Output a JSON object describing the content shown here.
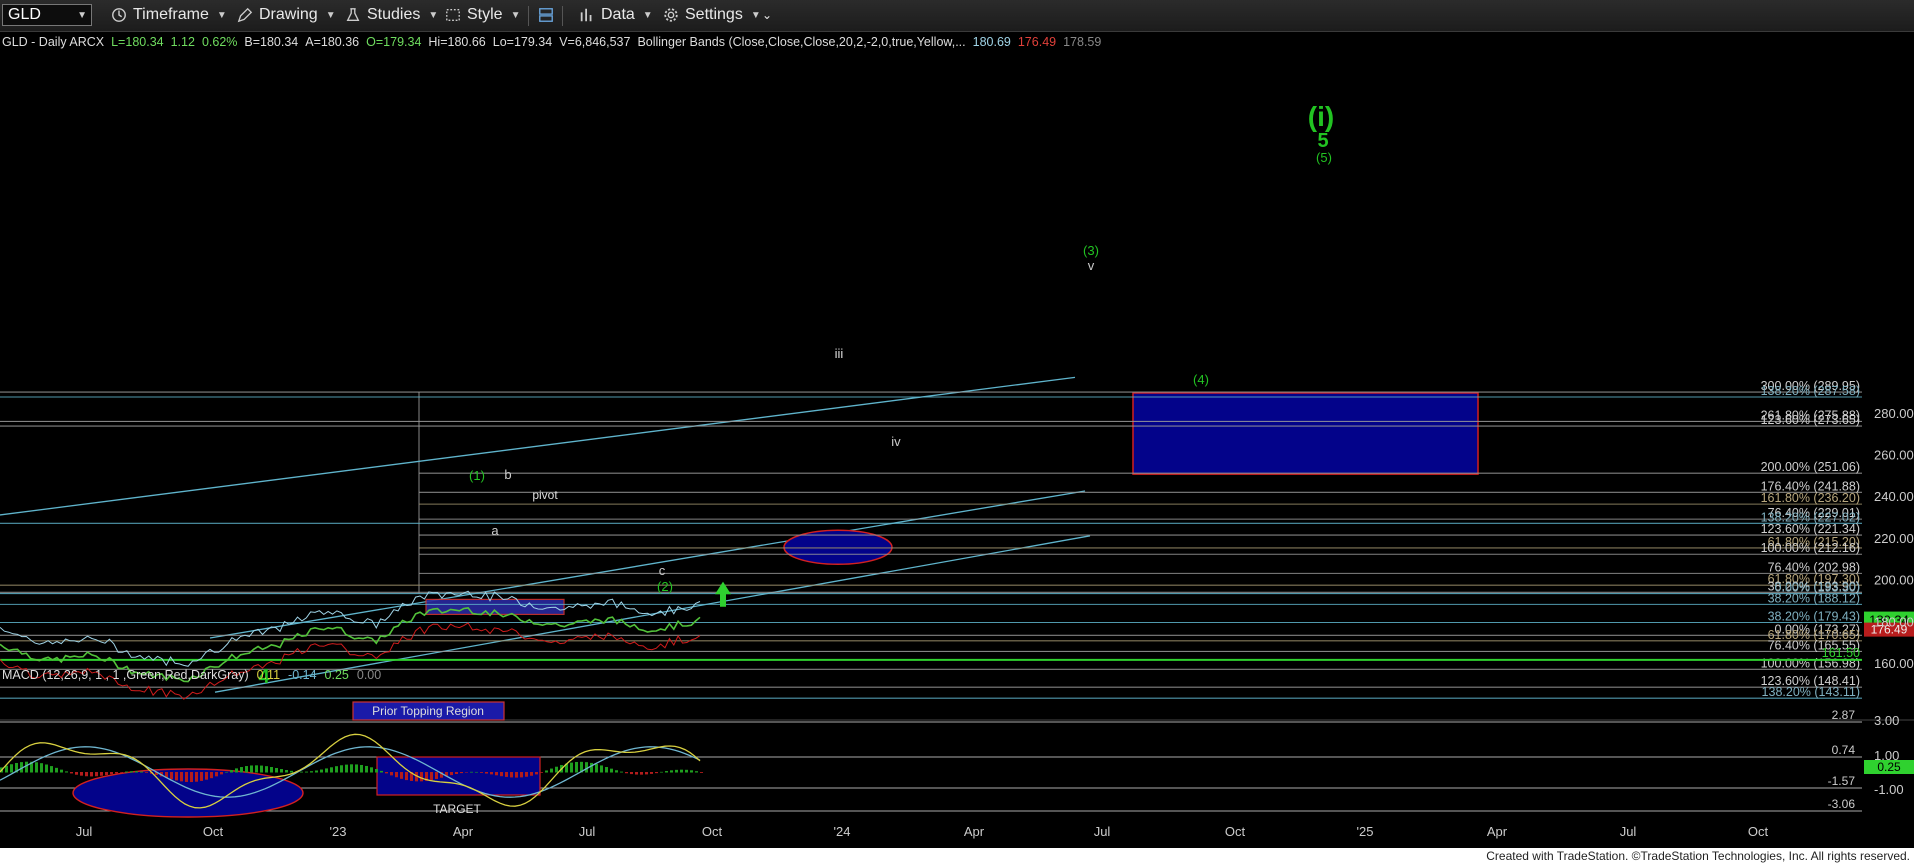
{
  "toolbar": {
    "symbol": "GLD",
    "timeframe_label": "Timeframe",
    "drawing_label": "Drawing",
    "studies_label": "Studies",
    "style_label": "Style",
    "data_label": "Data",
    "settings_label": "Settings"
  },
  "header": {
    "symbol_desc": "GLD - Daily  ARCX",
    "last": "L=180.34",
    "change": "1.12",
    "change_pct": "0.62%",
    "bid": "B=180.34",
    "ask": "A=180.36",
    "open": "O=179.34",
    "high": "Hi=180.66",
    "low": "Lo=179.34",
    "volume": "V=6,846,537",
    "study": "Bollinger Bands (Close,Close,Close,20,2,-2,0,true,Yellow,...",
    "bb_upper": "180.69",
    "bb_lower": "176.49",
    "bb_mid": "178.59"
  },
  "macd_header": {
    "label": "MACD (12,26,9, 1 , 1 ,Green,Red,DarkGray)",
    "v1": "0.11",
    "v2": "-0.14",
    "v3": "0.25",
    "v4": "0.00"
  },
  "colors": {
    "background": "#000000",
    "price": "#52c23a",
    "channel": "#5fb4cc",
    "fib": "#9a9a9a",
    "fib_text": "#cfcfcf",
    "fib_tan": "#9c8f6b",
    "green_level": "#2fd12f",
    "target_box": "#03038a",
    "target_box_border": "#d22020",
    "wave_green": "#22c322",
    "bb_upper": "#9fd3e6",
    "bb_lower": "#d01c1c",
    "macd_line": "#d8d040",
    "macd_signal": "#6fb6d0",
    "hist_pos": "#1f9f1f",
    "hist_neg": "#b21c1c"
  },
  "fib_levels": [
    {
      "label": "300.00% (289.95)",
      "value": 289.95,
      "tone": "grey"
    },
    {
      "label": "138.20% (287.58)",
      "value": 287.58,
      "tone": "teal"
    },
    {
      "label": "261.80% (275.88)",
      "value": 275.88,
      "tone": "grey"
    },
    {
      "label": "123.60% (273.65)",
      "value": 273.65,
      "tone": "grey"
    },
    {
      "label": "200.00% (251.06)",
      "value": 251.06,
      "tone": "grey"
    },
    {
      "label": "176.40% (241.88)",
      "value": 241.88,
      "tone": "grey"
    },
    {
      "label": "161.80% (236.20)",
      "value": 236.2,
      "tone": "tan"
    },
    {
      "label": "76.40% (229.01)",
      "value": 229.01,
      "tone": "grey"
    },
    {
      "label": "138.20% (227.02)",
      "value": 227.02,
      "tone": "teal"
    },
    {
      "label": "123.60% (221.34)",
      "value": 221.34,
      "tone": "grey"
    },
    {
      "label": "61.80% (215.20)",
      "value": 215.2,
      "tone": "tan"
    },
    {
      "label": "100.00% (212.16)",
      "value": 212.16,
      "tone": "grey"
    },
    {
      "label": "76.40% (202.98)",
      "value": 202.98,
      "tone": "grey"
    },
    {
      "label": "61.80% (197.30)",
      "value": 197.3,
      "tone": "tan"
    },
    {
      "label": "38.20% (193.90)",
      "value": 193.9,
      "tone": "grey"
    },
    {
      "label": "0.00% (193.30)",
      "value": 193.3,
      "tone": "teal"
    },
    {
      "label": "38.20% (188.12)",
      "value": 188.12,
      "tone": "teal"
    },
    {
      "label": "38.20% (179.43)",
      "value": 179.43,
      "tone": "teal"
    },
    {
      "label": "0.00% (173.27)",
      "value": 173.27,
      "tone": "grey"
    },
    {
      "label": "61.80% (170.65)",
      "value": 170.65,
      "tone": "tan"
    },
    {
      "label": "76.40% (165.55)",
      "value": 165.55,
      "tone": "grey"
    },
    {
      "label": "100.00% (156.98)",
      "value": 156.98,
      "tone": "grey"
    },
    {
      "label": "123.60% (148.41)",
      "value": 148.41,
      "tone": "grey"
    },
    {
      "label": "138.20% (143.11)",
      "value": 143.11,
      "tone": "teal"
    }
  ],
  "green_level": {
    "label": "161.50",
    "value": 161.5
  },
  "price_badges": {
    "last": "180.34",
    "lower": "176.49"
  },
  "price_axis": [
    "280.00",
    "260.00",
    "240.00",
    "220.00",
    "200.00",
    "180.00",
    "160.00"
  ],
  "macd_axis": [
    "3.00",
    "1.00",
    "-1.00"
  ],
  "macd_levels": [
    "2.87",
    "0.74",
    "-1.57",
    "-3.06"
  ],
  "macd_badge": "0.25",
  "time_axis": [
    "Jul",
    "Oct",
    "'23",
    "Apr",
    "Jul",
    "Oct",
    "'24",
    "Apr",
    "Jul",
    "Oct",
    "'25",
    "Apr",
    "Jul",
    "Oct"
  ],
  "annotations": {
    "target_wave": "(i)",
    "target_five": "5",
    "target_paren5": "(5)",
    "wave3": "(3)",
    "wave3_v": "v",
    "iii": "iii",
    "wave4": "(4)",
    "iv": "iv",
    "wave1": "(1)",
    "b": "b",
    "pivot": "pivot",
    "a": "a",
    "c": "c",
    "wave2": "(2)",
    "four": "4",
    "prior_topping": "Prior Topping Region",
    "target": "TARGET"
  },
  "chart_data": {
    "type": "line",
    "title": "GLD - Daily  ARCX",
    "price_ylim": [
      139,
      293
    ],
    "price_series": [
      {
        "date": "2022-06",
        "close": 169
      },
      {
        "date": "2022-07",
        "close": 161
      },
      {
        "date": "2022-08",
        "close": 164
      },
      {
        "date": "2022-09",
        "close": 155
      },
      {
        "date": "2022-10",
        "close": 152
      },
      {
        "date": "2022-11",
        "close": 163
      },
      {
        "date": "2022-12",
        "close": 169
      },
      {
        "date": "2023-01",
        "close": 178
      },
      {
        "date": "2023-02",
        "close": 170
      },
      {
        "date": "2023-03",
        "close": 184
      },
      {
        "date": "2023-04",
        "close": 186
      },
      {
        "date": "2023-05",
        "close": 182
      },
      {
        "date": "2023-06",
        "close": 178
      },
      {
        "date": "2023-07",
        "close": 181
      },
      {
        "date": "2023-08",
        "close": 176
      },
      {
        "date": "2023-09",
        "close": 180.34
      }
    ],
    "series": [
      {
        "name": "Bollinger Bands (Close,Close,Close,20,2,-2,0,true,Yellow,...",
        "last_values": [
          180.69,
          176.49,
          178.59
        ]
      },
      {
        "name": "MACD (12,26,9, 1 , 1 ,Green,Red,DarkGray)",
        "last_values": [
          0.11,
          -0.14,
          0.25,
          0.0
        ]
      }
    ],
    "macd_ylim": [
      -3.2,
      3.3
    ],
    "grid": false
  }
}
